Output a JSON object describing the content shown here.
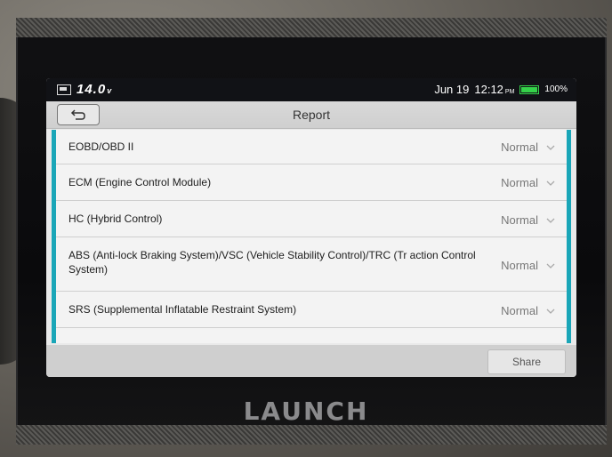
{
  "status": {
    "voltage": "14.0",
    "voltage_unit": "v",
    "date": "Jun 19",
    "time": "12:12",
    "ampm": "PM",
    "battery_percent": "100%",
    "battery_level": 1.0,
    "battery_color": "#35d24a"
  },
  "header": {
    "title": "Report"
  },
  "report": {
    "rows": [
      {
        "label": "EOBD/OBD II",
        "value": "Normal"
      },
      {
        "label": "ECM (Engine Control Module)",
        "value": "Normal"
      },
      {
        "label": "HC (Hybrid Control)",
        "value": "Normal"
      },
      {
        "label": "ABS (Anti-lock Braking System)/VSC (Vehicle Stability Control)/TRC (Tr action Control System)",
        "value": "Normal"
      },
      {
        "label": "SRS (Supplemental Inflatable Restraint System)",
        "value": "Normal"
      }
    ]
  },
  "footer": {
    "share_label": "Share"
  },
  "device": {
    "brand": "LAUNCH"
  },
  "colors": {
    "accent": "#1aa6b8"
  }
}
